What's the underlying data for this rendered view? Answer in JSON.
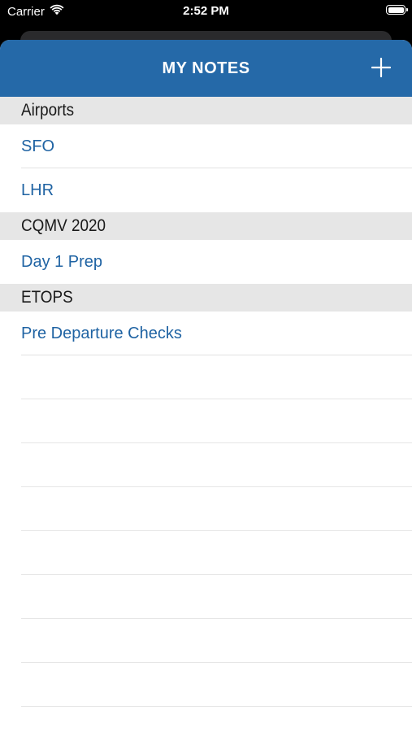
{
  "status_bar": {
    "carrier": "Carrier",
    "time": "2:52 PM"
  },
  "nav": {
    "title": "MY NOTES",
    "add_icon": "plus-icon"
  },
  "sections": [
    {
      "title": "Airports",
      "items": [
        {
          "label": "SFO"
        },
        {
          "label": "LHR"
        }
      ]
    },
    {
      "title": "CQMV 2020",
      "items": [
        {
          "label": "Day 1 Prep"
        }
      ]
    },
    {
      "title": "ETOPS",
      "items": [
        {
          "label": "Pre Departure Checks"
        }
      ]
    }
  ],
  "colors": {
    "nav_background": "#2569a8",
    "link_text": "#1f63a3",
    "section_background": "#e6e6e6"
  }
}
